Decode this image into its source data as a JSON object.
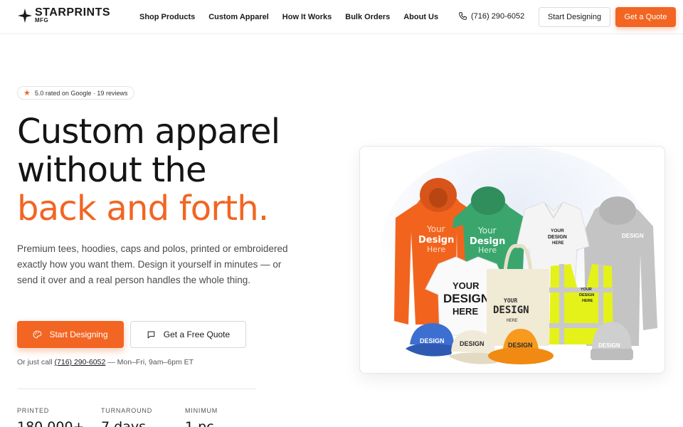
{
  "brand": {
    "name": "STARPRINTS",
    "sub": "MFG"
  },
  "nav": {
    "items": [
      "Shop Products",
      "Custom Apparel",
      "How It Works",
      "Bulk Orders",
      "About Us"
    ]
  },
  "header": {
    "phone": "(716) 290-6052",
    "start_designing": "Start Designing",
    "get_quote": "Get a Quote"
  },
  "hero": {
    "rating": "5.0 rated on Google · 19 reviews",
    "headline_line1": "Custom apparel",
    "headline_line2": "without the",
    "headline_accent": "back and forth.",
    "lede": "Premium tees, hoodies, caps and polos, printed or embroidered exactly how you want them. Design it yourself in minutes — or send it over and a real person handles the whole thing.",
    "primary_cta": "Start Designing",
    "secondary_cta": "Get a Free Quote",
    "call_prefix": "Or just call",
    "call_phone": "(716) 290-6052",
    "call_hours": "— Mon–Fri, 9am–6pm ET"
  },
  "stats": [
    {
      "label": "PRINTED",
      "value": "180,000+"
    },
    {
      "label": "TURNAROUND",
      "value": "7 days"
    },
    {
      "label": "MINIMUM",
      "value": "1 pc"
    }
  ],
  "product_image": {
    "mockup_text": {
      "your": "Your",
      "design": "Design",
      "here": "Here",
      "your_caps": "YOUR",
      "design_caps": "DESIGN",
      "here_caps": "HERE"
    }
  },
  "colors": {
    "accent": "#f26522",
    "text": "#141414",
    "hoodie_orange": "#f2641e",
    "hoodie_green": "#3aa66e",
    "safety_yellow": "#e4f219",
    "hoodie_grey": "#c2c2c2",
    "cap_blue": "#3d6fd1"
  },
  "icons": {
    "logo": "sparkle-star-icon",
    "phone": "phone-icon",
    "rating": "star-icon",
    "primary_cta": "palette-icon",
    "secondary_cta": "message-icon"
  }
}
